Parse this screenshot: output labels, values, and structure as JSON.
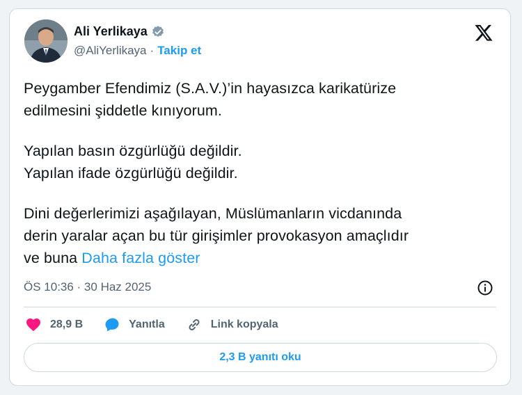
{
  "author": {
    "name": "Ali Yerlikaya",
    "handle": "@AliYerlikaya",
    "separator": "·",
    "follow_label": "Takip et"
  },
  "tweet": {
    "lines": [
      "Peygamber Efendimiz (S.A.V.)’in hayasızca karikatürize",
      "edilmesini şiddetle kınıyorum.",
      "Yapılan basın özgürlüğü değildir.",
      "Yapılan ifade özgürlüğü değildir.",
      "Dini değerlerimizi aşağılayan, Müslümanların vicdanında",
      "derin yaralar açan bu tür girişimler provokasyon amaçlıdır",
      "ve buna"
    ],
    "show_more": "Daha fazla göster",
    "timestamp": "ÖS 10:36 · 30 Haz 2025"
  },
  "actions": {
    "like_count": "28,9 B",
    "reply_label": "Yanıtla",
    "copy_link_label": "Link kopyala",
    "read_replies_label": "2,3 B yanıtı oku"
  },
  "icons": {
    "verified": "verified-badge-icon",
    "logo": "x-logo-icon",
    "info": "info-icon",
    "like": "heart-icon",
    "reply": "speech-bubble-icon",
    "link": "link-icon"
  },
  "colors": {
    "accent": "#1d9bf0",
    "like": "#f91880",
    "text": "#0f1419",
    "muted": "#536471",
    "border": "#cfd9de"
  }
}
